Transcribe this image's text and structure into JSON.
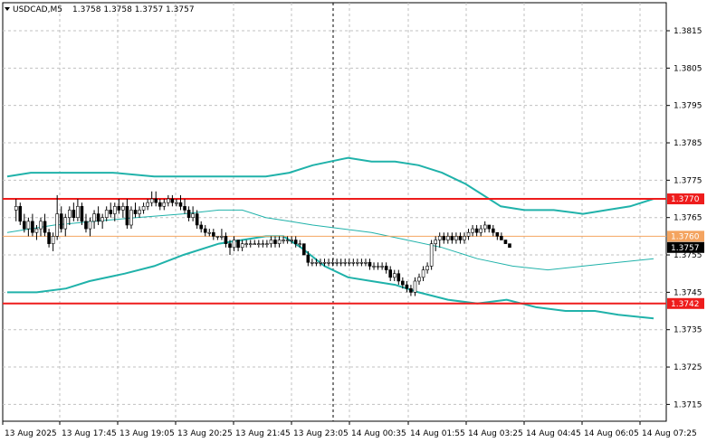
{
  "header": {
    "symbol_timeframe": "USDCAD,M5",
    "ohlc": "1.3758 1.3758 1.3757 1.3757"
  },
  "colors": {
    "background": "#ffffff",
    "grid": "#c0c0c0",
    "candle": "#000000",
    "bands": "#20b2aa",
    "ma": "#20b2aa",
    "level_line": "#ee1c1c",
    "current_line": "#f4a460",
    "current_tag_bg": "#000000"
  },
  "chart_data": {
    "type": "candlestick",
    "title": "USDCAD,M5",
    "y_ticks": [
      "1.3815",
      "1.3805",
      "1.3795",
      "1.3785",
      "1.3775",
      "1.3765",
      "1.3755",
      "1.3745",
      "1.3735",
      "1.3725",
      "1.3715"
    ],
    "ylim": [
      1.37105,
      1.38225
    ],
    "x_ticks": [
      "13 Aug 2025",
      "13 Aug 17:45",
      "13 Aug 19:05",
      "13 Aug 20:25",
      "13 Aug 21:45",
      "13 Aug 23:05",
      "14 Aug 00:35",
      "14 Aug 01:55",
      "14 Aug 03:25",
      "14 Aug 04:45",
      "14 Aug 06:05",
      "14 Aug 07:25"
    ],
    "levels": [
      {
        "label": "1.3770",
        "value": 1.377,
        "kind": "resistance"
      },
      {
        "label": "1.3760",
        "value": 1.376,
        "kind": "pivot"
      },
      {
        "label": "1.3742",
        "value": 1.3742,
        "kind": "support"
      }
    ],
    "current_price": {
      "label": "1.3757",
      "value": 1.3757
    },
    "grid": true,
    "candles_x": [
      0,
      0.7,
      1.4,
      2.1,
      2.8,
      3.5,
      4.2,
      4.9,
      5.6,
      6.3,
      7,
      7.7,
      8.4,
      9.1,
      9.8,
      10.5,
      11.2,
      11.9,
      12.6,
      13.3,
      14,
      14.7,
      15.4,
      16.1,
      16.8,
      17.5,
      18.2,
      18.9,
      19.6,
      20.3,
      21,
      21.7,
      22.4,
      23.1,
      23.8,
      24.5,
      25.2,
      25.9,
      26.6,
      27.3,
      28,
      28.7,
      29.4,
      30.1,
      30.8,
      31.5,
      32.2,
      32.9,
      33.6,
      34.3,
      35,
      35.7,
      36.4,
      37.1,
      37.8,
      38.5,
      39.2,
      39.9,
      40.6,
      41.3,
      42,
      42.7,
      43.4,
      44.1,
      44.8,
      45.5,
      46.2,
      46.9,
      47.6,
      48.3,
      49,
      49.7,
      50.4,
      51.1,
      51.8,
      52.5,
      53.2,
      53.9,
      54.6,
      55.3,
      56,
      56.7,
      57.4,
      58.1,
      58.8,
      59.5,
      60.2,
      60.9,
      61.6,
      62.3,
      63,
      63.7,
      64.4,
      65.1,
      65.8,
      66.5,
      67.2,
      67.9,
      68.6,
      69.3,
      70,
      70.7,
      71.4,
      72.1,
      72.8,
      73.5,
      74.2,
      74.9,
      75.6,
      76.3,
      77,
      77.7,
      78.4,
      79.1,
      79.8,
      80.5,
      81.2,
      81.9,
      82.6,
      83.3,
      84,
      84.7,
      85.4,
      86.1,
      86.8,
      87.5,
      88.2,
      88.9,
      89.6,
      90.3,
      91,
      91.7,
      92.4,
      93.1,
      93.8,
      94.5,
      95.2,
      95.9,
      96.6,
      97.3,
      98,
      98.7,
      99.4,
      100.1,
      100.8,
      101.5,
      102.2,
      102.9,
      103.6,
      104.3
    ],
    "candles": [
      [
        1.3767,
        1.377,
        1.3764,
        1.3768
      ],
      [
        1.3768,
        1.3769,
        1.3763,
        1.3764
      ],
      [
        1.3764,
        1.3766,
        1.3761,
        1.3762
      ],
      [
        1.3762,
        1.3765,
        1.376,
        1.3764
      ],
      [
        1.3764,
        1.3766,
        1.376,
        1.3761
      ],
      [
        1.3761,
        1.3763,
        1.3759,
        1.3762
      ],
      [
        1.3762,
        1.3765,
        1.376,
        1.3764
      ],
      [
        1.3764,
        1.3766,
        1.376,
        1.3761
      ],
      [
        1.3761,
        1.3762,
        1.3757,
        1.3758
      ],
      [
        1.3758,
        1.3761,
        1.3756,
        1.376
      ],
      [
        1.376,
        1.3771,
        1.3759,
        1.3766
      ],
      [
        1.3766,
        1.3768,
        1.3761,
        1.3762
      ],
      [
        1.3762,
        1.3766,
        1.376,
        1.3765
      ],
      [
        1.3765,
        1.3768,
        1.3763,
        1.3767
      ],
      [
        1.3767,
        1.3769,
        1.3764,
        1.3765
      ],
      [
        1.3765,
        1.377,
        1.3764,
        1.3768
      ],
      [
        1.3768,
        1.3769,
        1.3763,
        1.3764
      ],
      [
        1.3764,
        1.3766,
        1.3761,
        1.3762
      ],
      [
        1.3762,
        1.3765,
        1.376,
        1.3764
      ],
      [
        1.3764,
        1.3767,
        1.3762,
        1.3766
      ],
      [
        1.3766,
        1.3768,
        1.3763,
        1.3764
      ],
      [
        1.3764,
        1.3766,
        1.3762,
        1.3765
      ],
      [
        1.3765,
        1.3768,
        1.3764,
        1.3767
      ],
      [
        1.3767,
        1.3769,
        1.3765,
        1.3766
      ],
      [
        1.3766,
        1.3769,
        1.3764,
        1.3768
      ],
      [
        1.3768,
        1.377,
        1.3766,
        1.3767
      ],
      [
        1.3767,
        1.3769,
        1.3765,
        1.3768
      ],
      [
        1.3768,
        1.377,
        1.3762,
        1.3763
      ],
      [
        1.3763,
        1.3768,
        1.3762,
        1.3767
      ],
      [
        1.3767,
        1.3769,
        1.3765,
        1.3766
      ],
      [
        1.3766,
        1.3768,
        1.3765,
        1.3767
      ],
      [
        1.3767,
        1.3769,
        1.3766,
        1.3768
      ],
      [
        1.3768,
        1.377,
        1.3767,
        1.3769
      ],
      [
        1.3769,
        1.3772,
        1.3768,
        1.377
      ],
      [
        1.377,
        1.3772,
        1.3768,
        1.3769
      ],
      [
        1.3769,
        1.377,
        1.3767,
        1.3768
      ],
      [
        1.3768,
        1.377,
        1.3767,
        1.3769
      ],
      [
        1.3769,
        1.3771,
        1.3768,
        1.377
      ],
      [
        1.377,
        1.3771,
        1.3768,
        1.3769
      ],
      [
        1.3769,
        1.377,
        1.3768,
        1.3769
      ],
      [
        1.3769,
        1.3771,
        1.3767,
        1.3768
      ],
      [
        1.3768,
        1.377,
        1.3766,
        1.3767
      ],
      [
        1.3767,
        1.3768,
        1.3764,
        1.3765
      ],
      [
        1.3765,
        1.3768,
        1.3764,
        1.3766
      ],
      [
        1.3766,
        1.3767,
        1.3762,
        1.3763
      ],
      [
        1.3763,
        1.3764,
        1.3761,
        1.3762
      ],
      [
        1.3762,
        1.3763,
        1.376,
        1.3761
      ],
      [
        1.3761,
        1.3762,
        1.376,
        1.3761
      ],
      [
        1.3761,
        1.3762,
        1.3759,
        1.376
      ],
      [
        1.376,
        1.376,
        1.3759,
        1.376
      ],
      [
        1.376,
        1.3762,
        1.3759,
        1.376
      ],
      [
        1.376,
        1.3761,
        1.3757,
        1.3758
      ],
      [
        1.3758,
        1.3759,
        1.3755,
        1.3757
      ],
      [
        1.3757,
        1.376,
        1.3756,
        1.3759
      ],
      [
        1.3759,
        1.3759,
        1.3756,
        1.3757
      ],
      [
        1.3757,
        1.3759,
        1.3756,
        1.3758
      ],
      [
        1.3758,
        1.3759,
        1.3757,
        1.3758
      ],
      [
        1.3758,
        1.3759,
        1.3757,
        1.3758
      ],
      [
        1.3758,
        1.3759,
        1.3758,
        1.3758
      ],
      [
        1.3758,
        1.3759,
        1.3757,
        1.3758
      ],
      [
        1.3758,
        1.3759,
        1.3757,
        1.3758
      ],
      [
        1.3758,
        1.3759,
        1.3757,
        1.3758
      ],
      [
        1.3758,
        1.376,
        1.3757,
        1.3759
      ],
      [
        1.3759,
        1.376,
        1.3757,
        1.3758
      ],
      [
        1.3758,
        1.376,
        1.3757,
        1.3759
      ],
      [
        1.3759,
        1.376,
        1.3758,
        1.3759
      ],
      [
        1.3759,
        1.376,
        1.3758,
        1.3759
      ],
      [
        1.3759,
        1.376,
        1.3758,
        1.3759
      ],
      [
        1.3759,
        1.376,
        1.3757,
        1.3758
      ],
      [
        1.3758,
        1.3759,
        1.3757,
        1.3758
      ],
      [
        1.3758,
        1.3758,
        1.3755,
        1.3755
      ],
      [
        1.3755,
        1.3756,
        1.3752,
        1.3753
      ],
      [
        1.3753,
        1.3754,
        1.3752,
        1.3753
      ],
      [
        1.3753,
        1.3754,
        1.3752,
        1.3753
      ],
      [
        1.3753,
        1.3754,
        1.3752,
        1.3753
      ],
      [
        1.3753,
        1.3754,
        1.3752,
        1.3753
      ],
      [
        1.3753,
        1.3754,
        1.3752,
        1.3753
      ],
      [
        1.3753,
        1.3754,
        1.3752,
        1.3753
      ],
      [
        1.3753,
        1.3754,
        1.3752,
        1.3753
      ],
      [
        1.3753,
        1.3754,
        1.3752,
        1.3753
      ],
      [
        1.3753,
        1.3754,
        1.3752,
        1.3753
      ],
      [
        1.3753,
        1.3754,
        1.3752,
        1.3753
      ],
      [
        1.3753,
        1.3754,
        1.3752,
        1.3753
      ],
      [
        1.3753,
        1.3754,
        1.3752,
        1.3753
      ],
      [
        1.3753,
        1.3754,
        1.3752,
        1.3753
      ],
      [
        1.3753,
        1.3754,
        1.3752,
        1.3753
      ],
      [
        1.3753,
        1.3754,
        1.3751,
        1.3752
      ],
      [
        1.3752,
        1.3753,
        1.3751,
        1.3752
      ],
      [
        1.3752,
        1.3753,
        1.3751,
        1.3752
      ],
      [
        1.3752,
        1.3753,
        1.3751,
        1.3752
      ],
      [
        1.3752,
        1.3753,
        1.375,
        1.3751
      ],
      [
        1.3751,
        1.3752,
        1.3748,
        1.3749
      ],
      [
        1.3749,
        1.3751,
        1.3748,
        1.375
      ],
      [
        1.375,
        1.3751,
        1.3747,
        1.3748
      ],
      [
        1.3748,
        1.3749,
        1.3746,
        1.3747
      ],
      [
        1.3747,
        1.3748,
        1.3745,
        1.3746
      ],
      [
        1.3746,
        1.3747,
        1.3744,
        1.3745
      ],
      [
        1.3745,
        1.3749,
        1.3744,
        1.3748
      ],
      [
        1.3748,
        1.375,
        1.3747,
        1.3749
      ],
      [
        1.3749,
        1.3752,
        1.3748,
        1.3751
      ],
      [
        1.3751,
        1.3753,
        1.375,
        1.3752
      ],
      [
        1.3752,
        1.3759,
        1.3751,
        1.3758
      ],
      [
        1.3758,
        1.376,
        1.3756,
        1.3759
      ],
      [
        1.3759,
        1.3761,
        1.3757,
        1.376
      ],
      [
        1.376,
        1.3761,
        1.3758,
        1.3759
      ],
      [
        1.3759,
        1.3761,
        1.3758,
        1.376
      ],
      [
        1.376,
        1.3761,
        1.3758,
        1.3759
      ],
      [
        1.3759,
        1.3761,
        1.3758,
        1.376
      ],
      [
        1.376,
        1.3761,
        1.3758,
        1.3759
      ],
      [
        1.3759,
        1.3761,
        1.3758,
        1.376
      ],
      [
        1.376,
        1.3762,
        1.3759,
        1.3761
      ],
      [
        1.3761,
        1.3763,
        1.376,
        1.3762
      ],
      [
        1.3762,
        1.3763,
        1.376,
        1.3761
      ],
      [
        1.3761,
        1.3763,
        1.376,
        1.3762
      ],
      [
        1.3762,
        1.3764,
        1.3761,
        1.3763
      ],
      [
        1.3763,
        1.3763,
        1.3761,
        1.3762
      ],
      [
        1.3762,
        1.3763,
        1.376,
        1.3761
      ],
      [
        1.3761,
        1.3761,
        1.3759,
        1.376
      ],
      [
        1.376,
        1.3761,
        1.3759,
        1.3759
      ],
      [
        1.3759,
        1.3759,
        1.3758,
        1.3758
      ],
      [
        1.3758,
        1.3758,
        1.3757,
        1.3757
      ]
    ],
    "bands": {
      "upper": [
        [
          0,
          1.3776
        ],
        [
          4,
          1.3777
        ],
        [
          10,
          1.3777
        ],
        [
          18,
          1.3777
        ],
        [
          25,
          1.3776
        ],
        [
          32,
          1.3776
        ],
        [
          38,
          1.3776
        ],
        [
          44,
          1.3776
        ],
        [
          48,
          1.3777
        ],
        [
          52,
          1.3779
        ],
        [
          55,
          1.378
        ],
        [
          58,
          1.3781
        ],
        [
          62,
          1.378
        ],
        [
          66,
          1.378
        ],
        [
          70,
          1.3779
        ],
        [
          74,
          1.3777
        ],
        [
          78,
          1.3774
        ],
        [
          81,
          1.3771
        ],
        [
          84,
          1.3768
        ],
        [
          88,
          1.3767
        ],
        [
          93,
          1.3767
        ],
        [
          98,
          1.3766
        ],
        [
          102,
          1.3767
        ],
        [
          106,
          1.3768
        ],
        [
          110,
          1.377
        ]
      ],
      "middle": [
        [
          0,
          1.3761
        ],
        [
          8,
          1.3763
        ],
        [
          15,
          1.3764
        ],
        [
          22,
          1.3765
        ],
        [
          30,
          1.3766
        ],
        [
          36,
          1.3767
        ],
        [
          40,
          1.3767
        ],
        [
          44,
          1.3765
        ],
        [
          48,
          1.3764
        ],
        [
          52,
          1.3763
        ],
        [
          57,
          1.3762
        ],
        [
          62,
          1.3761
        ],
        [
          68,
          1.3759
        ],
        [
          74,
          1.3757
        ],
        [
          80,
          1.3754
        ],
        [
          86,
          1.3752
        ],
        [
          92,
          1.3751
        ],
        [
          98,
          1.3752
        ],
        [
          104,
          1.3753
        ],
        [
          110,
          1.3754
        ]
      ],
      "lower": [
        [
          0,
          1.3745
        ],
        [
          5,
          1.3745
        ],
        [
          10,
          1.3746
        ],
        [
          14,
          1.3748
        ],
        [
          20,
          1.375
        ],
        [
          25,
          1.3752
        ],
        [
          30,
          1.3755
        ],
        [
          36,
          1.3758
        ],
        [
          40,
          1.3759
        ],
        [
          44,
          1.376
        ],
        [
          47,
          1.376
        ],
        [
          50,
          1.3757
        ],
        [
          54,
          1.3752
        ],
        [
          58,
          1.3749
        ],
        [
          62,
          1.3748
        ],
        [
          66,
          1.3747
        ],
        [
          70,
          1.3745
        ],
        [
          75,
          1.3743
        ],
        [
          80,
          1.3742
        ],
        [
          85,
          1.3743
        ],
        [
          90,
          1.3741
        ],
        [
          95,
          1.374
        ],
        [
          100,
          1.374
        ],
        [
          104,
          1.3739
        ],
        [
          110,
          1.3738
        ]
      ]
    },
    "vertical_marker_index": 52
  }
}
